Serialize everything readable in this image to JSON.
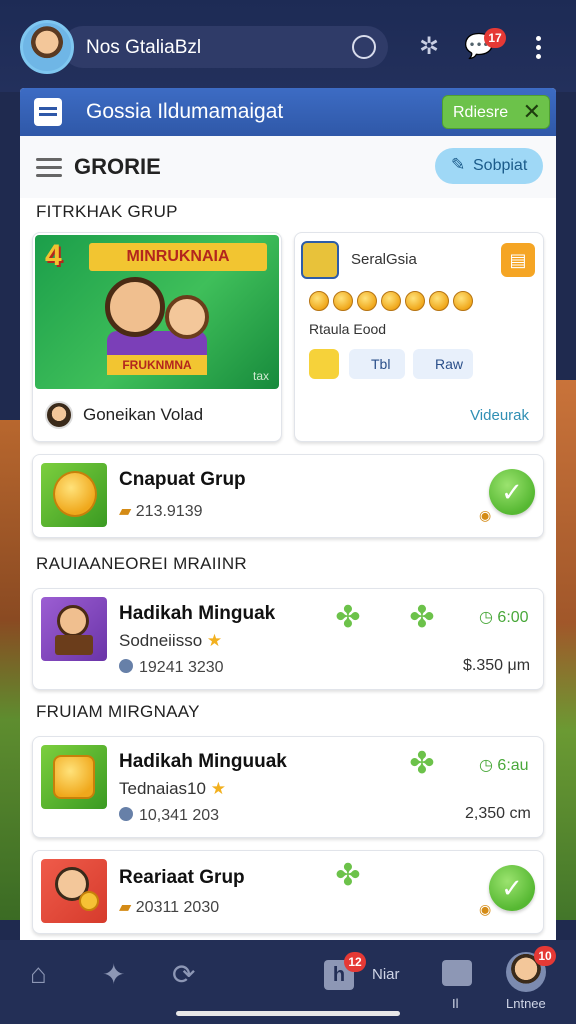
{
  "topbar": {
    "search_text": "Nos GtaliaBzl",
    "notif_badge": "17"
  },
  "panel": {
    "title": "Gossia Ildumamaigat",
    "release_label": "Rdiesre",
    "section_title": "GRORIE",
    "submit_label": "Sobpiat"
  },
  "featured": {
    "label": "FITRKHAK GRUP",
    "promo": {
      "number": "4",
      "banner": "MINRUKNAIA",
      "strip": "FRUKNMNA",
      "tag": "tax",
      "author": "Goneikan Volad"
    },
    "side_card": {
      "title": "SeralGsia",
      "reward_text": "Rtaula Eood",
      "pill1": "Tbl",
      "pill2": "Raw",
      "link": "Videurak"
    }
  },
  "group_card": {
    "title": "Cnapuat Grup",
    "meta": "213.9139"
  },
  "section2": {
    "label": "RAUIAANEOREI MRAIINR",
    "item": {
      "title": "Hadikah Minguak",
      "sub": "Sodneiisso",
      "meta": "19241 3230",
      "time": "6:00",
      "price": "$.350 μm"
    }
  },
  "section3": {
    "label": "FRUIAM MIRGNAAY",
    "item1": {
      "title": "Hadikah Minguuak",
      "sub": "Tednaias10",
      "meta": "10,341 203",
      "time": "6:au",
      "price": "2,350 cm"
    },
    "item2": {
      "title": "Reariaat Grup",
      "meta": "20311 2030"
    }
  },
  "bottomnav": {
    "chat_badge": "12",
    "chat_label": "Niar",
    "item4_label": "Il",
    "profile_label": "Lntnee",
    "profile_badge": "10"
  },
  "colors": {
    "accent_blue": "#2f58a8",
    "accent_green": "#6cc24a",
    "background_dark": "#1f2a4f"
  }
}
